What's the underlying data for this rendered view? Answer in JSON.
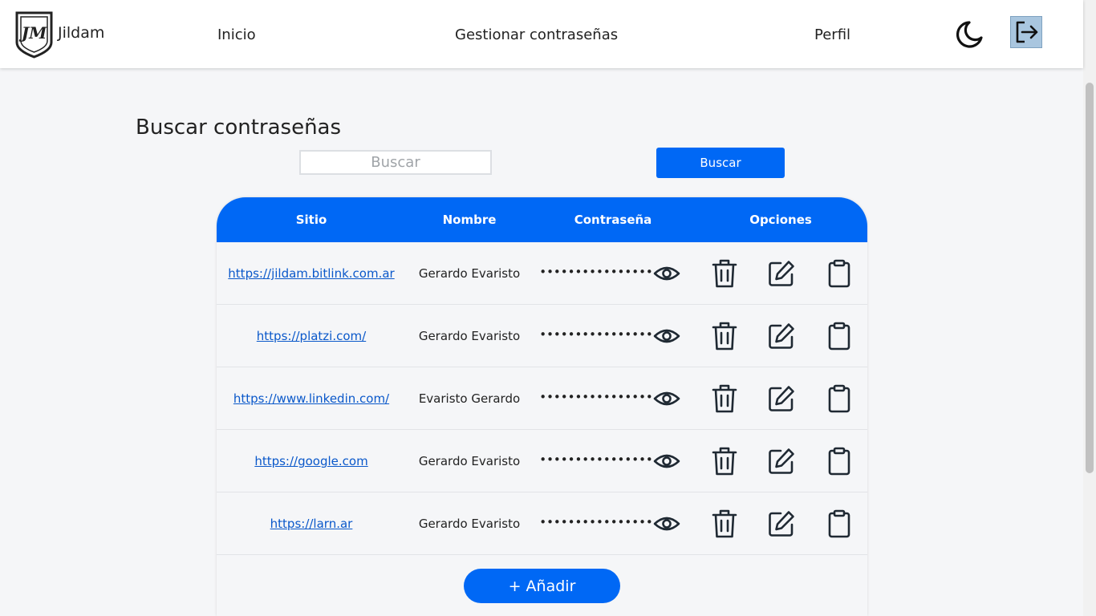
{
  "app": {
    "brand": "Jildam",
    "logo_text": "JM"
  },
  "nav": {
    "links": [
      "Inicio",
      "Gestionar contraseñas",
      "Perfil"
    ],
    "theme_icon": "moon-icon",
    "logout_icon": "logout-icon"
  },
  "page": {
    "title": "Buscar contraseñas"
  },
  "search": {
    "placeholder": "Buscar",
    "value": "",
    "button_label": "Buscar"
  },
  "table": {
    "headers": [
      "Sitio",
      "Nombre",
      "Contraseña",
      "Opciones"
    ],
    "rows": [
      {
        "site": "https://jildam.bitlink.com.ar",
        "name": "Gerardo Evaristo",
        "password": "••••••••••••••••"
      },
      {
        "site": "https://platzi.com/",
        "name": "Gerardo Evaristo",
        "password": "••••••••••••••••"
      },
      {
        "site": "https://www.linkedin.com/",
        "name": "Evaristo Gerardo",
        "password": "••••••••••••••••"
      },
      {
        "site": "https://google.com",
        "name": "Gerardo Evaristo",
        "password": "••••••••••••••••"
      },
      {
        "site": "https://larn.ar",
        "name": "Gerardo Evaristo",
        "password": "••••••••••••••••"
      }
    ],
    "option_icons": [
      "eye-icon",
      "trash-icon",
      "edit-icon",
      "clipboard-icon"
    ],
    "add_label": "+ Añadir"
  },
  "colors": {
    "primary": "#0068f5",
    "link": "#0a58ca",
    "background": "#f5f6f8",
    "logout_bg": "#a9c6df"
  }
}
